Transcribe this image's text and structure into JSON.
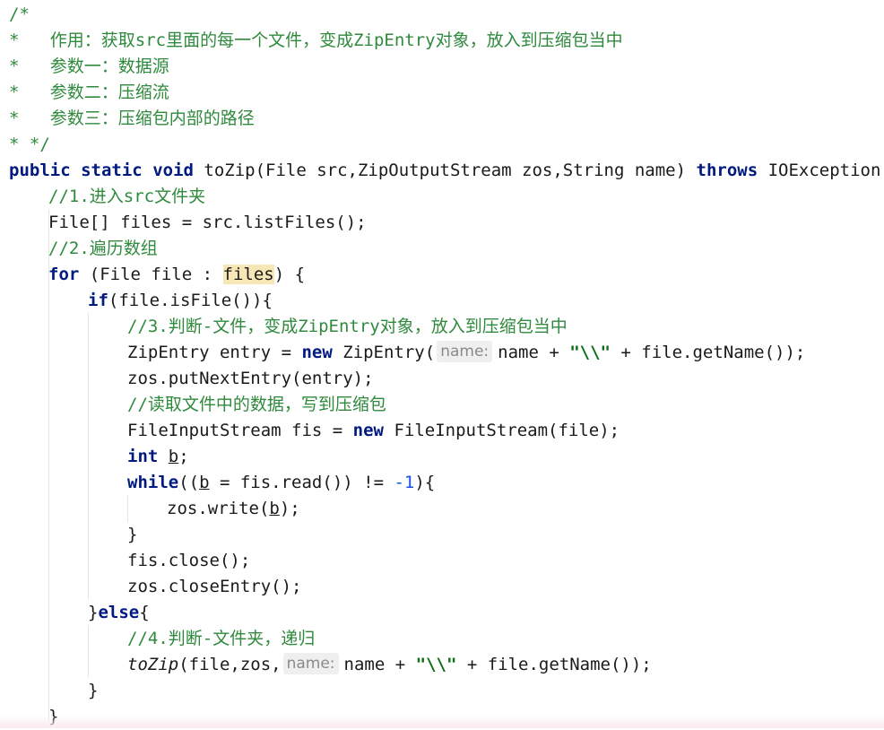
{
  "code_lines": {
    "l1": "/*",
    "l2": "*   作用：获取src里面的每一个文件，变成ZipEntry对象，放入到压缩包当中",
    "l3": "*   参数一：数据源",
    "l4": "*   参数二：压缩流",
    "l5": "*   参数三：压缩包内部的路径",
    "l6": "* */",
    "l7": {
      "kw1": "public",
      "kw2": "static",
      "kw3": "void",
      "sig": "toZip(File src,ZipOutputStream zos,String name)",
      "kw4": "throws",
      "rest": "IOException {"
    },
    "l8": "//1.进入src文件夹",
    "l9": "File[] files = src.listFiles();",
    "l10": "//2.遍历数组",
    "l11": {
      "kw": "for",
      "a": "(File file : ",
      "hl": "files",
      "b": ") {"
    },
    "l12": {
      "kw": "if",
      "rest": "(file.isFile()){"
    },
    "l13": "//3.判断-文件，变成ZipEntry对象，放入到压缩包当中",
    "l14": {
      "a": "ZipEntry entry = ",
      "kw": "new",
      "b": " ZipEntry(",
      "hint": "name:",
      "c": "name + ",
      "str": "\"\\\\\"",
      "d": " + file.getName());"
    },
    "l15": "zos.putNextEntry(entry);",
    "l16": "//读取文件中的数据，写到压缩包",
    "l17": {
      "a": "FileInputStream fis = ",
      "kw": "new",
      "b": " FileInputStream(file);"
    },
    "l18": {
      "kw": "int",
      "var": "b",
      "end": ";"
    },
    "l19": {
      "kw": "while",
      "a": "((",
      "var": "b",
      "b": " = fis.read()) != ",
      "num": "-1",
      "c": "){"
    },
    "l20": {
      "a": "zos.write(",
      "var": "b",
      "b": ");"
    },
    "l21": "}",
    "l22": "fis.close();",
    "l23": "zos.closeEntry();",
    "l24": {
      "a": "}",
      "kw": "else",
      "b": "{"
    },
    "l25": "//4.判断-文件夹，递归",
    "l26": {
      "call": "toZip",
      "a": "(file,zos,",
      "hint": "name:",
      "b": "name + ",
      "str": "\"\\\\\"",
      "c": " + file.getName());"
    },
    "l27": "}",
    "l28": "}"
  }
}
